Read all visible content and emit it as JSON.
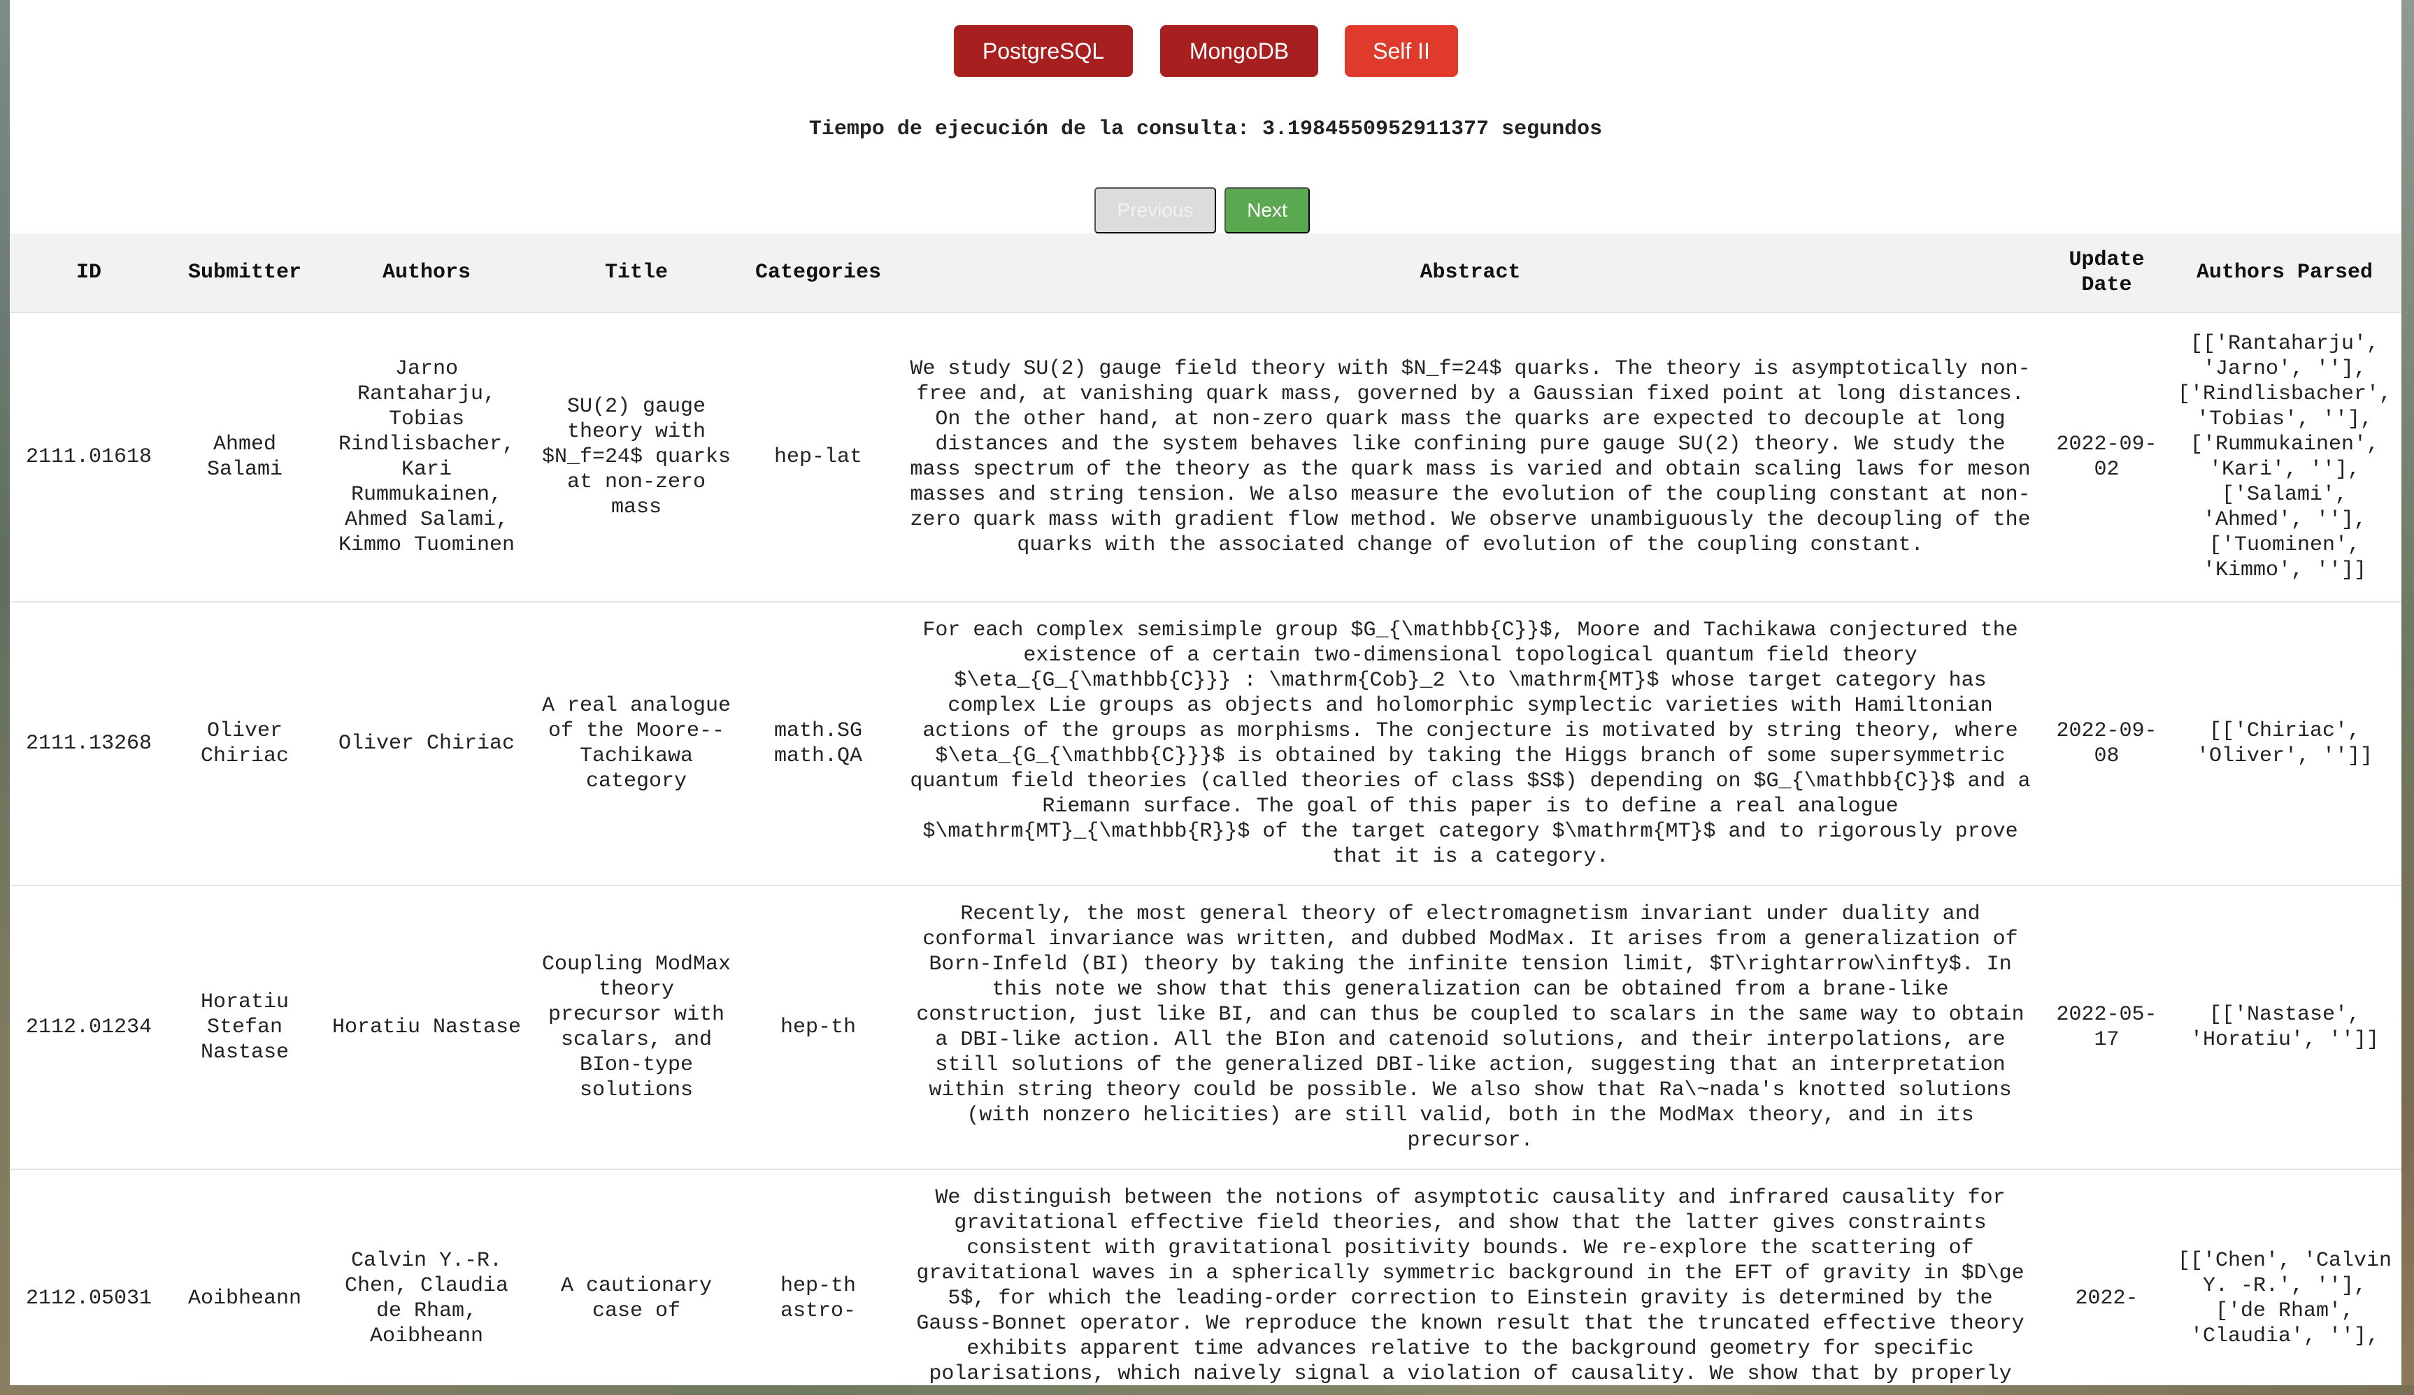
{
  "db_buttons": {
    "postgres": "PostgreSQL",
    "mongo": "MongoDB",
    "self": "Self II"
  },
  "timing_text": "Tiempo de ejecución de la consulta: 3.1984550952911377 segundos",
  "pagination": {
    "previous": "Previous",
    "next": "Next"
  },
  "table": {
    "headers": [
      "ID",
      "Submitter",
      "Authors",
      "Title",
      "Categories",
      "Abstract",
      "Update Date",
      "Authors Parsed"
    ],
    "rows": [
      {
        "id": "2111.01618",
        "submitter": "Ahmed Salami",
        "authors": "Jarno Rantaharju, Tobias Rindlisbacher, Kari Rummukainen, Ahmed Salami, Kimmo Tuominen",
        "title": "SU(2) gauge theory with $N_f=24$ quarks at non-zero mass",
        "categories": [
          "hep-lat"
        ],
        "abstract": "We study SU(2) gauge field theory with $N_f=24$ quarks. The theory is asymptotically non-free and, at vanishing quark mass, governed by a Gaussian fixed point at long distances. On the other hand, at non-zero quark mass the quarks are expected to decouple at long distances and the system behaves like confining pure gauge SU(2) theory. We study the mass spectrum of the theory as the quark mass is varied and obtain scaling laws for meson masses and string tension. We also measure the evolution of the coupling constant at non-zero quark mass with gradient flow method. We observe unambiguously the decoupling of the quarks with the associated change of evolution of the coupling constant.",
        "update_date": "2022-09-02",
        "authors_parsed": "[['Rantaharju', 'Jarno', ''], ['Rindlisbacher', 'Tobias', ''], ['Rummukainen', 'Kari', ''], ['Salami', 'Ahmed', ''], ['Tuominen', 'Kimmo', '']]"
      },
      {
        "id": "2111.13268",
        "submitter": "Oliver Chiriac",
        "authors": "Oliver Chiriac",
        "title": "A real analogue of the Moore--Tachikawa category",
        "categories": [
          "math.SG",
          "math.QA"
        ],
        "abstract": "For each complex semisimple group $G_{\\mathbb{C}}$, Moore and Tachikawa conjectured the existence of a certain two-dimensional topological quantum field theory $\\eta_{G_{\\mathbb{C}}} : \\mathrm{Cob}_2 \\to \\mathrm{MT}$ whose target category has complex Lie groups as objects and holomorphic symplectic varieties with Hamiltonian actions of the groups as morphisms. The conjecture is motivated by string theory, where $\\eta_{G_{\\mathbb{C}}}$ is obtained by taking the Higgs branch of some supersymmetric quantum field theories (called theories of class $S$) depending on $G_{\\mathbb{C}}$ and a Riemann surface. The goal of this paper is to define a real analogue $\\mathrm{MT}_{\\mathbb{R}}$ of the target category $\\mathrm{MT}$ and to rigorously prove that it is a category.",
        "update_date": "2022-09-08",
        "authors_parsed": "[['Chiriac', 'Oliver', '']]"
      },
      {
        "id": "2112.01234",
        "submitter": "Horatiu Stefan Nastase",
        "authors": "Horatiu Nastase",
        "title": "Coupling ModMax theory precursor with scalars, and BIon-type solutions",
        "categories": [
          "hep-th"
        ],
        "abstract": "Recently, the most general theory of electromagnetism invariant under duality and conformal invariance was written, and dubbed ModMax. It arises from a generalization of Born-Infeld (BI) theory by taking the infinite tension limit, $T\\rightarrow\\infty$. In this note we show that this generalization can be obtained from a brane-like construction, just like BI, and can thus be coupled to scalars in the same way to obtain a DBI-like action. All the BIon and catenoid solutions, and their interpolations, are still solutions of the generalized DBI-like action, suggesting that an interpretation within string theory could be possible. We also show that Ra\\~nada's knotted solutions (with nonzero helicities) are still valid, both in the ModMax theory, and in its precursor.",
        "update_date": "2022-05-17",
        "authors_parsed": "[['Nastase', 'Horatiu', '']]"
      },
      {
        "id": "2112.05031",
        "submitter": "Aoibheann",
        "authors": "Calvin Y.-R. Chen, Claudia de Rham, Aoibheann",
        "title": "A cautionary case of",
        "categories": [
          "hep-th",
          "astro-"
        ],
        "abstract": "We distinguish between the notions of asymptotic causality and infrared causality for gravitational effective field theories, and show that the latter gives constraints consistent with gravitational positivity bounds. We re-explore the scattering of gravitational waves in a spherically symmetric background in the EFT of gravity in $D\\ge 5$, for which the leading-order correction to Einstein gravity is determined by the Gauss-Bonnet operator. We reproduce the known result that the truncated effective theory exhibits apparent time advances relative to the background geometry for specific polarisations, which naively signal a violation of causality. We show that by properly identifying the regime of validity of the",
        "update_date": "2022-",
        "authors_parsed": "[['Chen', 'Calvin Y. -R.', ''], ['de Rham', 'Claudia', ''],"
      }
    ]
  },
  "colors": {
    "db_button": "#a71f1f",
    "self_button": "#e03a2c",
    "next_button": "#5aa84f",
    "previous_button": "#dcdcdc",
    "header_bg": "#f2f2f2"
  }
}
